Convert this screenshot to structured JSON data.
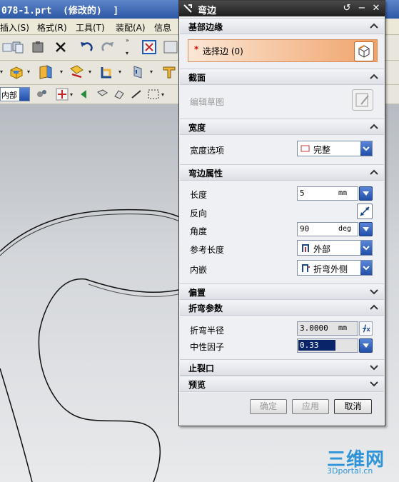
{
  "app": {
    "title": "078-1.prt  (修改的)  ]",
    "menu": [
      "插入(S)",
      "格式(R)",
      "工具(T)",
      "装配(A)",
      "信息"
    ],
    "layer_combo": "内部"
  },
  "dialog": {
    "title": "弯边",
    "sections": {
      "base_edge": {
        "header": "基部边缘",
        "required_marker": "*",
        "select_label": "选择边 (0)"
      },
      "section": {
        "header": "截面",
        "edit_sketch": "编辑草图"
      },
      "width": {
        "header": "宽度",
        "option_label": "宽度选项",
        "option_value": "完整"
      },
      "flange_props": {
        "header": "弯边属性",
        "length_label": "长度",
        "length_value": "5",
        "length_unit": "mm",
        "reverse_label": "反向",
        "angle_label": "角度",
        "angle_value": "90",
        "angle_unit": "deg",
        "ref_length_label": "参考长度",
        "ref_length_value": "外部",
        "inset_label": "内嵌",
        "inset_value": "折弯外侧"
      },
      "offset": {
        "header": "偏置"
      },
      "bend_params": {
        "header": "折弯参数",
        "radius_label": "折弯半径",
        "radius_value": "3.0000",
        "radius_unit": "mm",
        "neutral_label": "中性因子",
        "neutral_value": "0.33"
      },
      "relief": {
        "header": "止裂口"
      },
      "preview": {
        "header": "预览"
      }
    },
    "buttons": {
      "ok": "确定",
      "apply": "应用",
      "cancel": "取消"
    }
  },
  "watermark": {
    "big": "三维网",
    "small": "3Dportal.cn"
  },
  "colors": {
    "accent_orange": "#f0a36a",
    "spin_blue": "#2d5cb8",
    "titlebar_dark": "#1e1e1e",
    "watermark_blue": "#2f95d8"
  }
}
